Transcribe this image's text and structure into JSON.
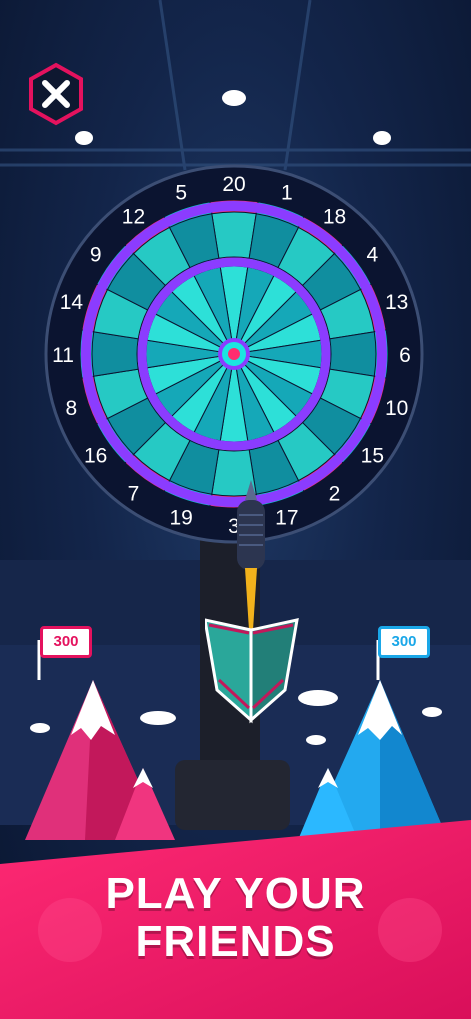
{
  "close_button": {
    "icon": "close-icon"
  },
  "dartboard": {
    "numbers": [
      "20",
      "1",
      "18",
      "4",
      "13",
      "6",
      "10",
      "15",
      "2",
      "17",
      "3",
      "19",
      "7",
      "16",
      "8",
      "11",
      "14",
      "9",
      "12",
      "5"
    ]
  },
  "player_left": {
    "score": "300",
    "color": "#e4125e"
  },
  "player_right": {
    "score": "300",
    "color": "#1aa7e8"
  },
  "banner": {
    "line1": "PLAY YOUR",
    "line2": "FRIENDS",
    "color_start": "#ff1f6b",
    "color_end": "#e0105d"
  }
}
